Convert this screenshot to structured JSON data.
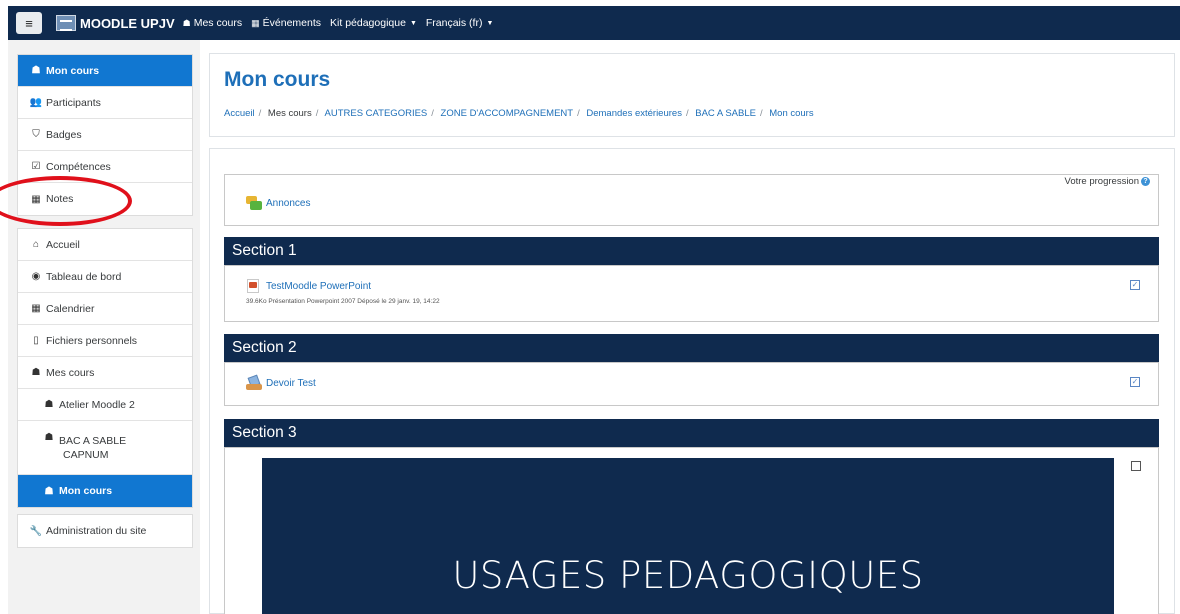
{
  "navbar": {
    "brand": "MOODLE UPJV",
    "links": [
      {
        "label": "Mes cours",
        "icon": "graduation-cap-icon"
      },
      {
        "label": "Événements",
        "icon": "calendar-icon"
      },
      {
        "label": "Kit pédagogique",
        "icon": ""
      },
      {
        "label": "Français (fr)",
        "icon": ""
      }
    ]
  },
  "drawer": {
    "course_nav": [
      {
        "label": "Mon cours",
        "icon": "graduation-cap-icon"
      },
      {
        "label": "Participants",
        "icon": "users-icon"
      },
      {
        "label": "Badges",
        "icon": "shield-icon"
      },
      {
        "label": "Compétences",
        "icon": "check-square-icon"
      },
      {
        "label": "Notes",
        "icon": "table-icon"
      }
    ],
    "site_nav": [
      {
        "label": "Accueil",
        "icon": "home-icon"
      },
      {
        "label": "Tableau de bord",
        "icon": "dashboard-icon"
      },
      {
        "label": "Calendrier",
        "icon": "calendar-icon"
      },
      {
        "label": "Fichiers personnels",
        "icon": "file-icon"
      },
      {
        "label": "Mes cours",
        "icon": "graduation-cap-icon"
      },
      {
        "label": "Atelier Moodle 2",
        "icon": "graduation-cap-icon"
      },
      {
        "label_line1": "BAC A SABLE",
        "label_line2": "CAPNUM",
        "icon": "graduation-cap-icon"
      },
      {
        "label": "Mon cours",
        "icon": "graduation-cap-icon"
      }
    ],
    "admin": {
      "label": "Administration du site",
      "icon": "wrench-icon"
    }
  },
  "header": {
    "title": "Mon cours",
    "breadcrumb": [
      "Accueil",
      "Mes cours",
      "AUTRES CATEGORIES",
      "ZONE D'ACCOMPAGNEMENT",
      "Demandes extérieures",
      "BAC A SABLE",
      "Mon cours"
    ]
  },
  "course": {
    "progress_label": "Votre progression",
    "intro_activity": "Annonces",
    "sections": [
      {
        "title": "Section 1",
        "activity": "TestMoodle PowerPoint",
        "meta": "39.6Ko Présentation Powerpoint 2007 Déposé le 29 janv. 19, 14:22",
        "completed": true
      },
      {
        "title": "Section 2",
        "activity": "Devoir Test",
        "completed": true
      },
      {
        "title": "Section 3",
        "banner_text": "USAGES PEDAGOGIQUES",
        "completed": false
      }
    ]
  },
  "colors": {
    "navbar": "#0f2a4e",
    "active": "#1177d1",
    "link": "#1e6fb8",
    "annotation": "#e0101b"
  }
}
